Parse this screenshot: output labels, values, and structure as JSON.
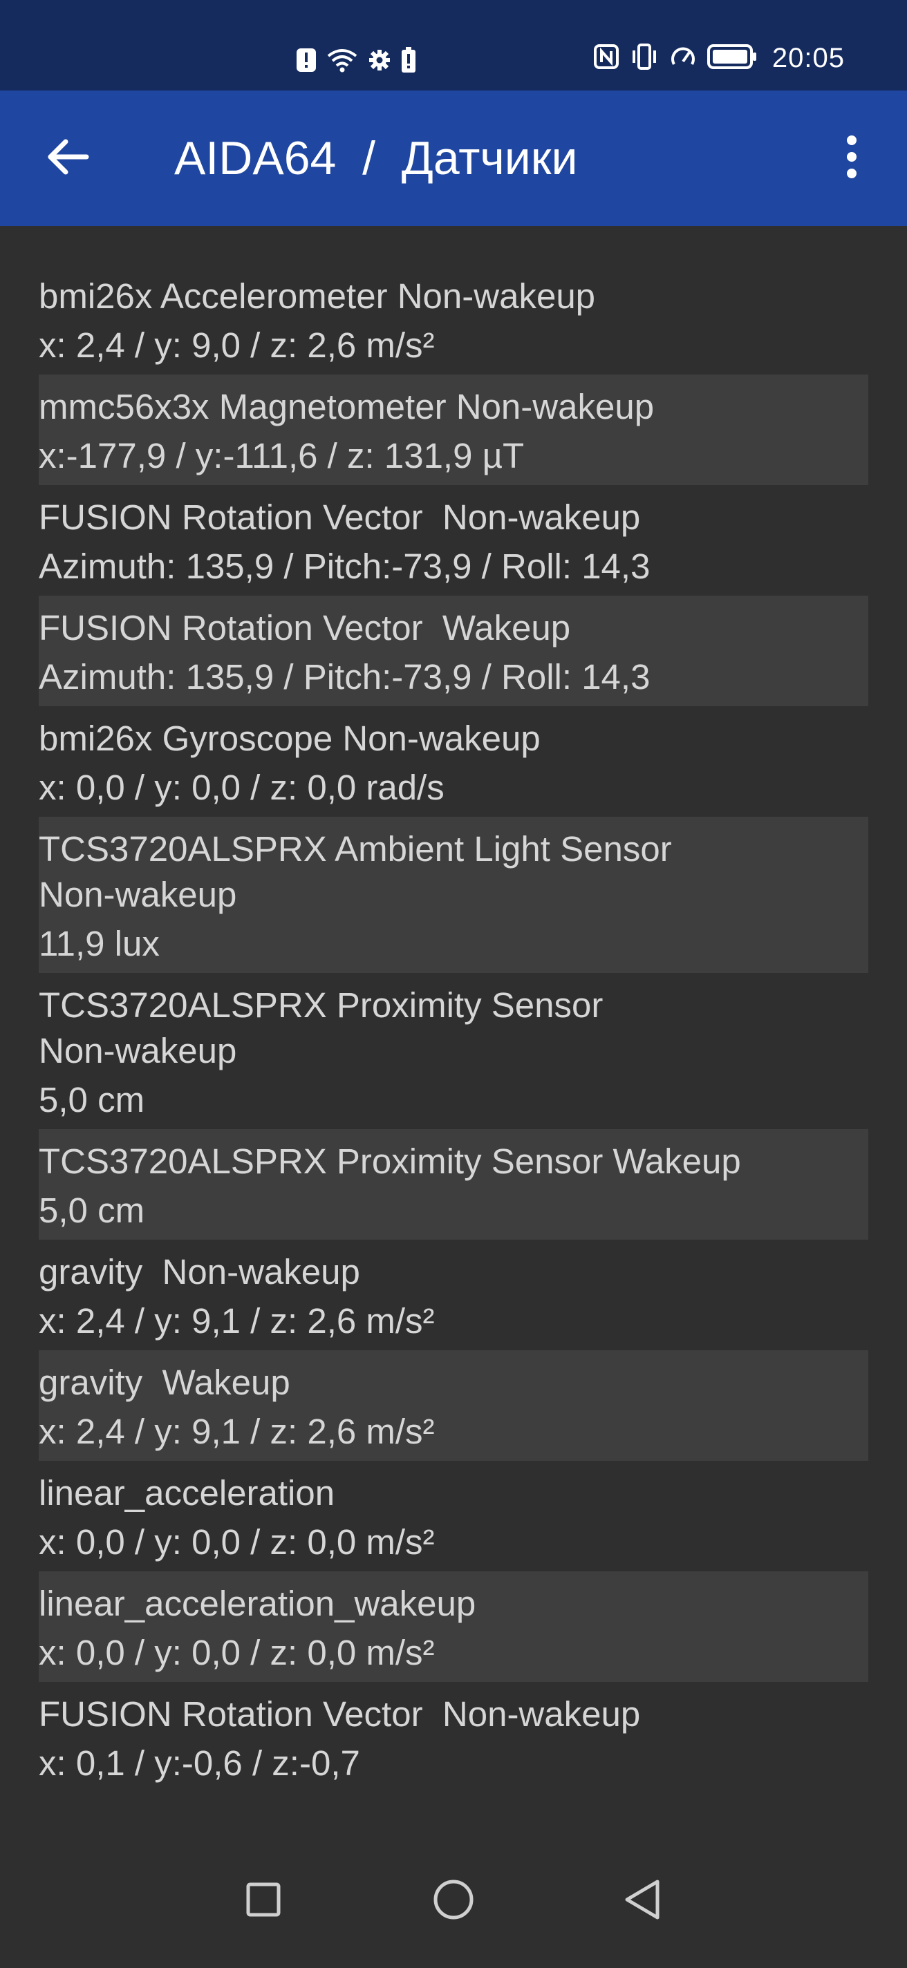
{
  "status_bar": {
    "time": "20:05",
    "left_icons": [
      "alert-icon",
      "wifi-icon",
      "gear-icon",
      "battery-alert-icon"
    ],
    "right_icons": [
      "nfc-icon",
      "vibrate-icon",
      "speed-icon",
      "battery-icon"
    ]
  },
  "app_bar": {
    "title": "AIDA64  /  Датчики",
    "background": "#1f46a0"
  },
  "sensors": [
    {
      "name": "bmi26x Accelerometer Non-wakeup",
      "value": "x: 2,4 / y: 9,0 / z: 2,6 m/s²"
    },
    {
      "name": "mmc56x3x Magnetometer Non-wakeup",
      "value": "x:-177,9 / y:-111,6 / z: 131,9 µT"
    },
    {
      "name": "FUSION Rotation Vector  Non-wakeup",
      "value": "Azimuth: 135,9 / Pitch:-73,9 / Roll: 14,3"
    },
    {
      "name": "FUSION Rotation Vector  Wakeup",
      "value": "Azimuth: 135,9 / Pitch:-73,9 / Roll: 14,3"
    },
    {
      "name": "bmi26x Gyroscope Non-wakeup",
      "value": "x: 0,0 / y: 0,0 / z: 0,0 rad/s"
    },
    {
      "name": "TCS3720ALSPRX Ambient Light Sensor\nNon-wakeup",
      "value": "11,9 lux"
    },
    {
      "name": "TCS3720ALSPRX Proximity Sensor\nNon-wakeup",
      "value": "5,0 cm"
    },
    {
      "name": "TCS3720ALSPRX Proximity Sensor Wakeup",
      "value": "5,0 cm"
    },
    {
      "name": "gravity  Non-wakeup",
      "value": "x: 2,4 / y: 9,1 / z: 2,6 m/s²"
    },
    {
      "name": "gravity  Wakeup",
      "value": "x: 2,4 / y: 9,1 / z: 2,6 m/s²"
    },
    {
      "name": "linear_acceleration",
      "value": "x: 0,0 / y: 0,0 / z: 0,0 m/s²"
    },
    {
      "name": "linear_acceleration_wakeup",
      "value": "x: 0,0 / y: 0,0 / z: 0,0 m/s²"
    },
    {
      "name": "FUSION Rotation Vector  Non-wakeup",
      "value": "x: 0,1 / y:-0,6 / z:-0,7"
    }
  ],
  "nav_bar": {
    "buttons": [
      "recents-icon",
      "home-icon",
      "back-icon"
    ]
  }
}
